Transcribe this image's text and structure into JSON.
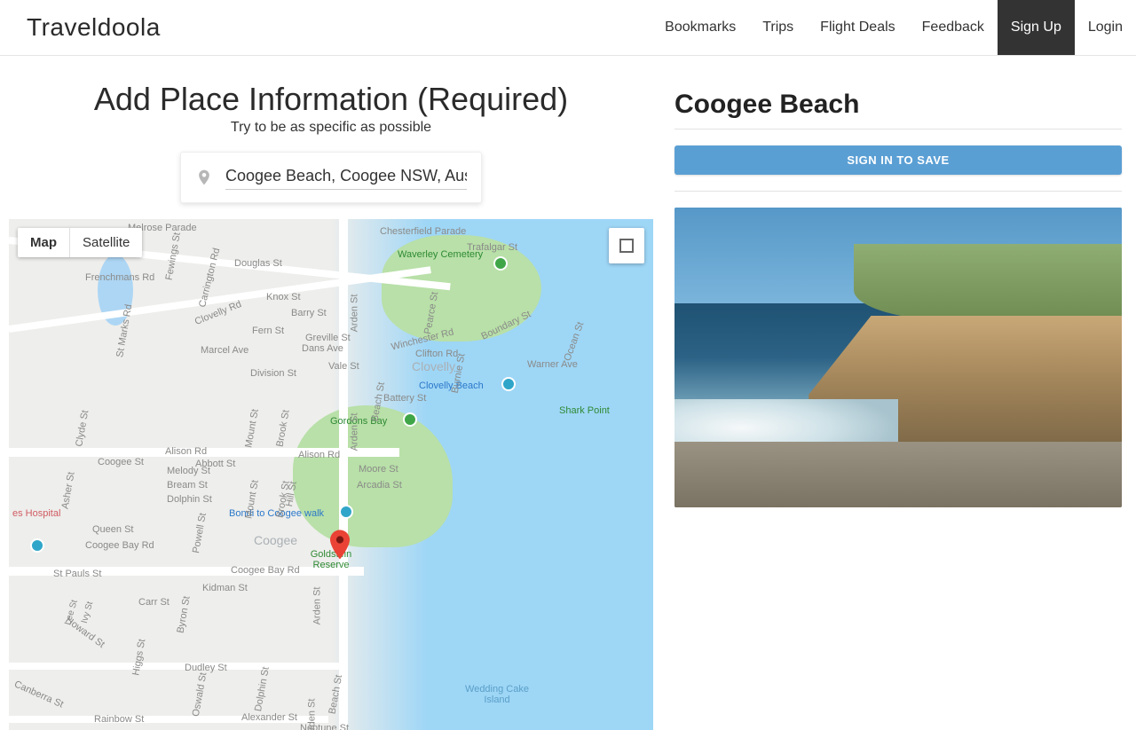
{
  "brand": "Traveldoola",
  "nav": {
    "bookmarks": "Bookmarks",
    "trips": "Trips",
    "flight_deals": "Flight Deals",
    "feedback": "Feedback",
    "signup": "Sign Up",
    "login": "Login"
  },
  "page": {
    "title": "Add Place Information (Required)",
    "subtitle": "Try to be as specific as possible"
  },
  "search": {
    "value": "Coogee Beach, Coogee NSW, Australia"
  },
  "map": {
    "type_map": "Map",
    "type_satellite": "Satellite",
    "labels": {
      "clovelly": "Clovelly",
      "coogee": "Coogee",
      "clovelly_beach": "Clovelly Beach",
      "shark_point": "Shark Point",
      "gordons_bay": "Gordons Bay",
      "bondi_walk": "Bondi to Coogee walk",
      "goldstein_reserve": "Goldstein Reserve",
      "wedding_cake": "Wedding Cake Island",
      "waverley_cemetery": "Waverley Cemetery",
      "hospital": "es Hospital"
    },
    "roads": {
      "arden": "Arden St",
      "alison": "Alison Rd",
      "clovelly_rd": "Clovelly Rd",
      "carrington": "Carrington Rd",
      "coogee_bay": "Coogee Bay Rd",
      "boundary": "Boundary St",
      "brook": "Brook St",
      "mount": "Mount St",
      "dudley": "Dudley St",
      "rainbow": "Rainbow St",
      "howard": "Howard St",
      "canberra": "Canberra St",
      "higgs": "Higgs St",
      "carr": "Carr St",
      "queen": "Queen St",
      "powell": "Powell St",
      "bream": "Bream St",
      "dolphin": "Dolphin St",
      "abbott": "Abbott St",
      "melody": "Melody St",
      "coogee_st": "Coogee St",
      "dans": "Dans Ave",
      "division": "Division St",
      "greville": "Greville St",
      "fern": "Fern St",
      "knox": "Knox St",
      "barry": "Barry St",
      "douglas": "Douglas St",
      "trafalgar": "Trafalgar St",
      "chesterfield": "Chesterfield Parade",
      "winchester": "Winchester Rd",
      "battery": "Battery St",
      "moore": "Moore St",
      "arcadia": "Arcadia St",
      "beach_st": "Beach St",
      "neptune": "Neptune St",
      "alexander": "Alexander St",
      "kidman": "Kidman St",
      "byron": "Byron St",
      "ocean": "Ocean St",
      "warner": "Warner Ave",
      "burnie": "Burnie St",
      "pearce": "Pearce St",
      "clifton": "Clifton Rd",
      "melrose": "Melrose Parade",
      "st_pauls": "St Pauls St",
      "asher": "Asher St",
      "clyde": "Clyde St",
      "marcel": "Marcel Ave",
      "st_marks": "St Marks Rd",
      "frenchmans": "Frenchmans Rd",
      "fewings": "Fewings St",
      "hill": "Hill St",
      "vale": "Vale St"
    }
  },
  "place": {
    "title": "Coogee Beach",
    "signin_button": "SIGN IN TO SAVE"
  }
}
